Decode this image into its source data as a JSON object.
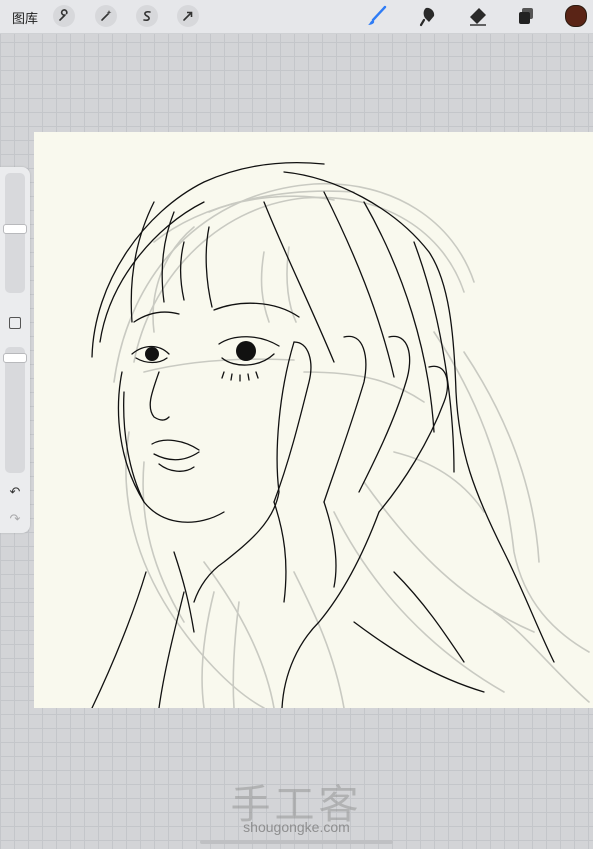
{
  "topbar": {
    "gallery_label": "图库",
    "left_tools": [
      "wrench-icon",
      "magic-wand-icon",
      "selection-icon",
      "transform-arrow-icon"
    ],
    "right_tools": [
      "brush-icon",
      "smudge-icon",
      "eraser-icon",
      "layers-icon"
    ],
    "active_tool": "brush-icon",
    "accent_color": "#2f7cf6",
    "current_color": "#5a2416"
  },
  "canvas": {
    "background": "#f9f9ee",
    "ink_color": "#111111",
    "sketch_color": "#c9cac2"
  },
  "sidebar": {
    "brush_size_level": 0.49,
    "opacity_level": 0.05,
    "undo_glyph": "↶",
    "redo_glyph": "↷"
  },
  "watermark": {
    "title": "手工客",
    "url": "shougongke.com"
  }
}
